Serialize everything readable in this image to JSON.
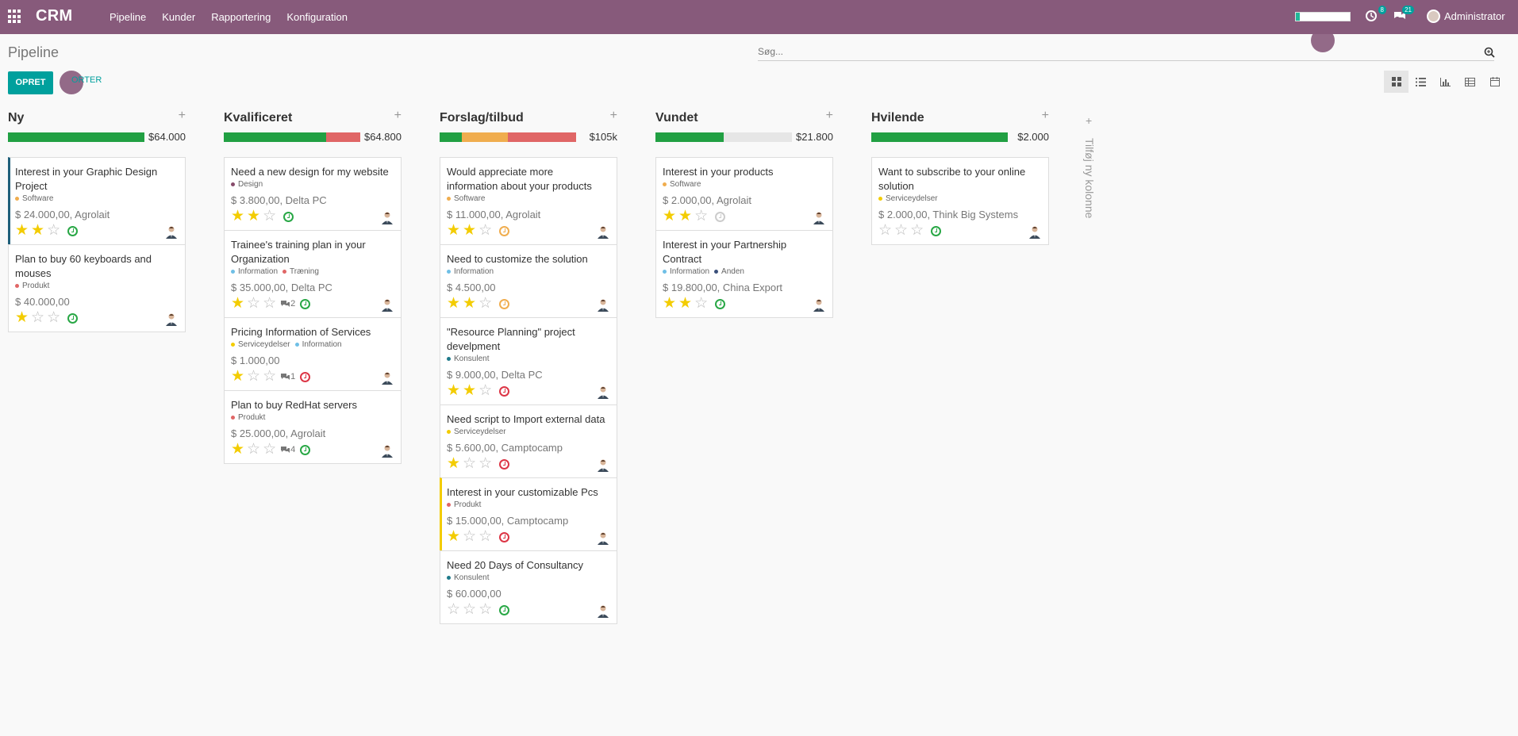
{
  "app": {
    "name": "CRM"
  },
  "nav": [
    "Pipeline",
    "Kunder",
    "Rapportering",
    "Konfiguration"
  ],
  "systray": {
    "activities_count": "8",
    "messages_count": "21",
    "user_name": "Administrator"
  },
  "breadcrumb": "Pipeline",
  "search": {
    "placeholder": "Søg..."
  },
  "buttons": {
    "create": "OPRET",
    "import": "ORTER"
  },
  "add_column_label": "Tilføj ny kolonne",
  "colors": {
    "topbar": "#875a7b",
    "primary": "#00a09d",
    "green": "#21a043",
    "orange": "#f0ad4e",
    "red": "#e06666"
  },
  "columns": [
    {
      "title": "Ny",
      "total": "$64.000",
      "bar": [
        {
          "color": "#21a043",
          "pct": 100
        }
      ],
      "cards": [
        {
          "title": "Interest in your Graphic Design Project",
          "tags": [
            {
              "name": "Software",
              "color": "#f0ad4e"
            }
          ],
          "amount": "$ 24.000,00, Agrolait",
          "stars": 2,
          "messages": "",
          "activity": "green",
          "highlight": "blue"
        },
        {
          "title": "Plan to buy 60 keyboards and mouses",
          "tags": [
            {
              "name": "Produkt",
              "color": "#e06666"
            }
          ],
          "amount": "$ 40.000,00",
          "stars": 1,
          "messages": "",
          "activity": "green",
          "highlight": ""
        }
      ]
    },
    {
      "title": "Kvalificeret",
      "total": "$64.800",
      "bar": [
        {
          "color": "#21a043",
          "pct": 75
        },
        {
          "color": "#e06666",
          "pct": 25
        }
      ],
      "cards": [
        {
          "title": "Need a new design for my website",
          "tags": [
            {
              "name": "Design",
              "color": "#874b6b"
            }
          ],
          "amount": "$ 3.800,00, Delta PC",
          "stars": 2,
          "messages": "",
          "activity": "green",
          "highlight": ""
        },
        {
          "title": "Trainee's training plan in your Organization",
          "tags": [
            {
              "name": "Information",
              "color": "#6fbfe6"
            },
            {
              "name": "Træning",
              "color": "#e06666"
            }
          ],
          "amount": "$ 35.000,00, Delta PC",
          "stars": 1,
          "messages": "2",
          "activity": "green",
          "highlight": ""
        },
        {
          "title": "Pricing Information of Services",
          "tags": [
            {
              "name": "Serviceydelser",
              "color": "#f3cc00"
            },
            {
              "name": "Information",
              "color": "#6fbfe6"
            }
          ],
          "amount": "$ 1.000,00",
          "stars": 1,
          "messages": "1",
          "activity": "red",
          "highlight": ""
        },
        {
          "title": "Plan to buy RedHat servers",
          "tags": [
            {
              "name": "Produkt",
              "color": "#e06666"
            }
          ],
          "amount": "$ 25.000,00, Agrolait",
          "stars": 1,
          "messages": "4",
          "activity": "green",
          "highlight": ""
        }
      ]
    },
    {
      "title": "Forslag/tilbud",
      "total": "$105k",
      "bar": [
        {
          "color": "#21a043",
          "pct": 16
        },
        {
          "color": "#f0ad4e",
          "pct": 34
        },
        {
          "color": "#e06666",
          "pct": 50
        }
      ],
      "cards": [
        {
          "title": "Would appreciate more information about your products",
          "tags": [
            {
              "name": "Software",
              "color": "#f0ad4e"
            }
          ],
          "amount": "$ 11.000,00, Agrolait",
          "stars": 2,
          "messages": "",
          "activity": "orange",
          "highlight": ""
        },
        {
          "title": "Need to customize the solution",
          "tags": [
            {
              "name": "Information",
              "color": "#6fbfe6"
            }
          ],
          "amount": "$ 4.500,00",
          "stars": 2,
          "messages": "",
          "activity": "orange",
          "highlight": ""
        },
        {
          "title": "\"Resource Planning\" project develpment",
          "tags": [
            {
              "name": "Konsulent",
              "color": "#1f7a8a"
            }
          ],
          "amount": "$ 9.000,00, Delta PC",
          "stars": 2,
          "messages": "",
          "activity": "red",
          "highlight": ""
        },
        {
          "title": "Need script to Import external data",
          "tags": [
            {
              "name": "Serviceydelser",
              "color": "#f3cc00"
            }
          ],
          "amount": "$ 5.600,00, Camptocamp",
          "stars": 1,
          "messages": "",
          "activity": "red",
          "highlight": ""
        },
        {
          "title": "Interest in your customizable Pcs",
          "tags": [
            {
              "name": "Produkt",
              "color": "#e06666"
            }
          ],
          "amount": "$ 15.000,00, Camptocamp",
          "stars": 1,
          "messages": "",
          "activity": "red",
          "highlight": "yellow"
        },
        {
          "title": "Need 20 Days of Consultancy",
          "tags": [
            {
              "name": "Konsulent",
              "color": "#1f7a8a"
            }
          ],
          "amount": "$ 60.000,00",
          "stars": 0,
          "messages": "",
          "activity": "green",
          "highlight": ""
        }
      ]
    },
    {
      "title": "Vundet",
      "total": "$21.800",
      "bar": [
        {
          "color": "#21a043",
          "pct": 50
        },
        {
          "color": "#e6e6e6",
          "pct": 50
        }
      ],
      "cards": [
        {
          "title": "Interest in your products",
          "tags": [
            {
              "name": "Software",
              "color": "#f0ad4e"
            }
          ],
          "amount": "$ 2.000,00, Agrolait",
          "stars": 2,
          "messages": "",
          "activity": "gray",
          "highlight": ""
        },
        {
          "title": "Interest in your Partnership Contract",
          "tags": [
            {
              "name": "Information",
              "color": "#6fbfe6"
            },
            {
              "name": "Anden",
              "color": "#3a4f7a"
            }
          ],
          "amount": "$ 19.800,00, China Export",
          "stars": 2,
          "messages": "",
          "activity": "green",
          "highlight": ""
        }
      ]
    },
    {
      "title": "Hvilende",
      "total": "$2.000",
      "bar": [
        {
          "color": "#21a043",
          "pct": 100
        }
      ],
      "cards": [
        {
          "title": "Want to subscribe to your online solution",
          "tags": [
            {
              "name": "Serviceydelser",
              "color": "#f3cc00"
            }
          ],
          "amount": "$ 2.000,00, Think Big Systems",
          "stars": 0,
          "messages": "",
          "activity": "green",
          "highlight": ""
        }
      ]
    }
  ]
}
